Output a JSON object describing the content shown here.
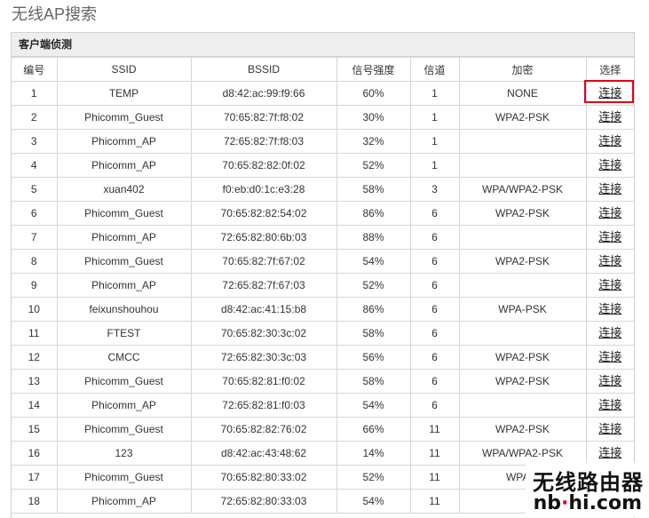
{
  "page": {
    "title": "无线AP搜索"
  },
  "panel": {
    "title": "客户端侦测"
  },
  "table": {
    "headers": [
      "编号",
      "SSID",
      "BSSID",
      "信号强度",
      "信道",
      "加密",
      "选择"
    ],
    "rows": [
      {
        "no": "1",
        "ssid": "TEMP",
        "bssid": "d8:42:ac:99:f9:66",
        "signal": "60%",
        "channel": "1",
        "enc": "NONE",
        "action": "连接"
      },
      {
        "no": "2",
        "ssid": "Phicomm_Guest",
        "bssid": "70:65:82:7f:f8:02",
        "signal": "30%",
        "channel": "1",
        "enc": "WPA2-PSK",
        "action": "连接"
      },
      {
        "no": "3",
        "ssid": "Phicomm_AP",
        "bssid": "72:65:82:7f:f8:03",
        "signal": "32%",
        "channel": "1",
        "enc": "",
        "action": "连接"
      },
      {
        "no": "4",
        "ssid": "Phicomm_AP",
        "bssid": "70:65:82:82:0f:02",
        "signal": "52%",
        "channel": "1",
        "enc": "",
        "action": "连接"
      },
      {
        "no": "5",
        "ssid": "xuan402",
        "bssid": "f0:eb:d0:1c:e3:28",
        "signal": "58%",
        "channel": "3",
        "enc": "WPA/WPA2-PSK",
        "action": "连接"
      },
      {
        "no": "6",
        "ssid": "Phicomm_Guest",
        "bssid": "70:65:82:82:54:02",
        "signal": "86%",
        "channel": "6",
        "enc": "WPA2-PSK",
        "action": "连接"
      },
      {
        "no": "7",
        "ssid": "Phicomm_AP",
        "bssid": "72:65:82:80:6b:03",
        "signal": "88%",
        "channel": "6",
        "enc": "",
        "action": "连接"
      },
      {
        "no": "8",
        "ssid": "Phicomm_Guest",
        "bssid": "70:65:82:7f:67:02",
        "signal": "54%",
        "channel": "6",
        "enc": "WPA2-PSK",
        "action": "连接"
      },
      {
        "no": "9",
        "ssid": "Phicomm_AP",
        "bssid": "72:65:82:7f:67:03",
        "signal": "52%",
        "channel": "6",
        "enc": "",
        "action": "连接"
      },
      {
        "no": "10",
        "ssid": "feixunshouhou",
        "bssid": "d8:42:ac:41:15:b8",
        "signal": "86%",
        "channel": "6",
        "enc": "WPA-PSK",
        "action": "连接"
      },
      {
        "no": "11",
        "ssid": "FTEST",
        "bssid": "70:65:82:30:3c:02",
        "signal": "58%",
        "channel": "6",
        "enc": "",
        "action": "连接"
      },
      {
        "no": "12",
        "ssid": "CMCC",
        "bssid": "72:65:82:30:3c:03",
        "signal": "56%",
        "channel": "6",
        "enc": "WPA2-PSK",
        "action": "连接"
      },
      {
        "no": "13",
        "ssid": "Phicomm_Guest",
        "bssid": "70:65:82:81:f0:02",
        "signal": "58%",
        "channel": "6",
        "enc": "WPA2-PSK",
        "action": "连接"
      },
      {
        "no": "14",
        "ssid": "Phicomm_AP",
        "bssid": "72:65:82:81:f0:03",
        "signal": "54%",
        "channel": "6",
        "enc": "",
        "action": "连接"
      },
      {
        "no": "15",
        "ssid": "Phicomm_Guest",
        "bssid": "70:65:82:82:76:02",
        "signal": "66%",
        "channel": "11",
        "enc": "WPA2-PSK",
        "action": "连接"
      },
      {
        "no": "16",
        "ssid": "123",
        "bssid": "d8:42:ac:43:48:62",
        "signal": "14%",
        "channel": "11",
        "enc": "WPA/WPA2-PSK",
        "action": "连接"
      },
      {
        "no": "17",
        "ssid": "Phicomm_Guest",
        "bssid": "70:65:82:80:33:02",
        "signal": "52%",
        "channel": "11",
        "enc": "WPA2-",
        "action": ""
      },
      {
        "no": "18",
        "ssid": "Phicomm_AP",
        "bssid": "72:65:82:80:33:03",
        "signal": "54%",
        "channel": "11",
        "enc": "",
        "action": ""
      }
    ]
  },
  "watermark": {
    "cn": "无线路由器",
    "en_left": "nb",
    "en_right": "hi.com"
  },
  "colors": {
    "highlight": "#e0001b",
    "border": "#d2d2d2",
    "header_bg": "#eeeeee"
  }
}
